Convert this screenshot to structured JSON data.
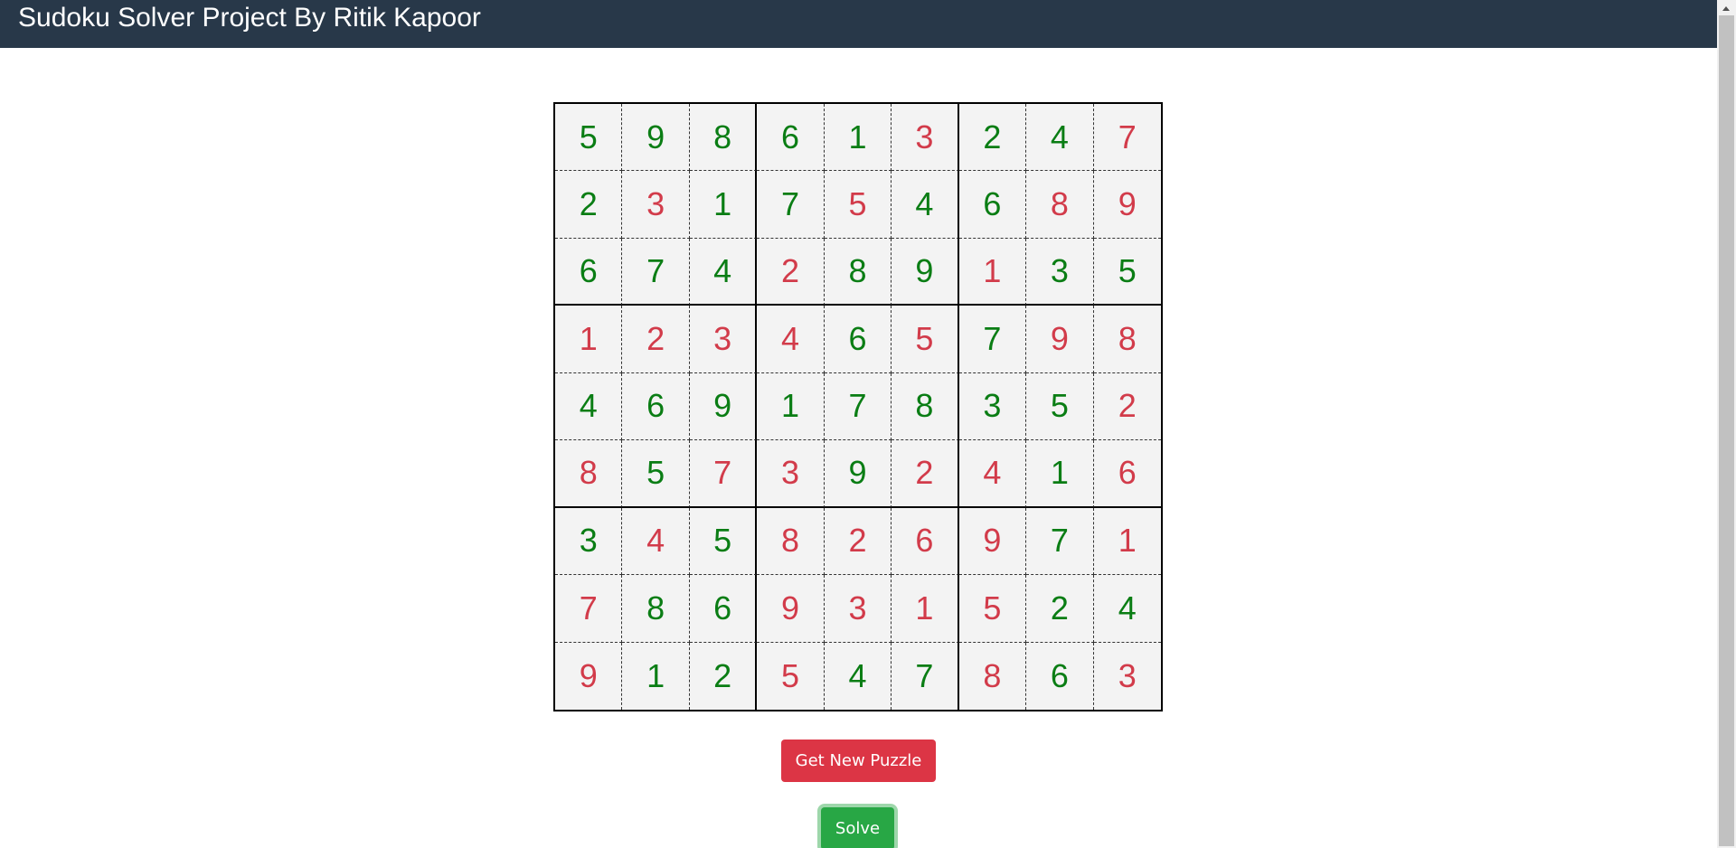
{
  "header": {
    "title": "Sudoku Solver Project By Ritik Kapoor"
  },
  "colors": {
    "header_bg": "#283849",
    "given_digit": "#0a7d14",
    "solved_digit": "#d23b4a",
    "new_puzzle_button": "#dc3545",
    "solve_button": "#28a745"
  },
  "grid": [
    [
      {
        "v": "5",
        "given": true
      },
      {
        "v": "9",
        "given": true
      },
      {
        "v": "8",
        "given": true
      },
      {
        "v": "6",
        "given": true
      },
      {
        "v": "1",
        "given": true
      },
      {
        "v": "3",
        "given": false
      },
      {
        "v": "2",
        "given": true
      },
      {
        "v": "4",
        "given": true
      },
      {
        "v": "7",
        "given": false
      }
    ],
    [
      {
        "v": "2",
        "given": true
      },
      {
        "v": "3",
        "given": false
      },
      {
        "v": "1",
        "given": true
      },
      {
        "v": "7",
        "given": true
      },
      {
        "v": "5",
        "given": false
      },
      {
        "v": "4",
        "given": true
      },
      {
        "v": "6",
        "given": true
      },
      {
        "v": "8",
        "given": false
      },
      {
        "v": "9",
        "given": false
      }
    ],
    [
      {
        "v": "6",
        "given": true
      },
      {
        "v": "7",
        "given": true
      },
      {
        "v": "4",
        "given": true
      },
      {
        "v": "2",
        "given": false
      },
      {
        "v": "8",
        "given": true
      },
      {
        "v": "9",
        "given": true
      },
      {
        "v": "1",
        "given": false
      },
      {
        "v": "3",
        "given": true
      },
      {
        "v": "5",
        "given": true
      }
    ],
    [
      {
        "v": "1",
        "given": false
      },
      {
        "v": "2",
        "given": false
      },
      {
        "v": "3",
        "given": false
      },
      {
        "v": "4",
        "given": false
      },
      {
        "v": "6",
        "given": true
      },
      {
        "v": "5",
        "given": false
      },
      {
        "v": "7",
        "given": true
      },
      {
        "v": "9",
        "given": false
      },
      {
        "v": "8",
        "given": false
      }
    ],
    [
      {
        "v": "4",
        "given": true
      },
      {
        "v": "6",
        "given": true
      },
      {
        "v": "9",
        "given": true
      },
      {
        "v": "1",
        "given": true
      },
      {
        "v": "7",
        "given": true
      },
      {
        "v": "8",
        "given": true
      },
      {
        "v": "3",
        "given": true
      },
      {
        "v": "5",
        "given": true
      },
      {
        "v": "2",
        "given": false
      }
    ],
    [
      {
        "v": "8",
        "given": false
      },
      {
        "v": "5",
        "given": true
      },
      {
        "v": "7",
        "given": false
      },
      {
        "v": "3",
        "given": false
      },
      {
        "v": "9",
        "given": true
      },
      {
        "v": "2",
        "given": false
      },
      {
        "v": "4",
        "given": false
      },
      {
        "v": "1",
        "given": true
      },
      {
        "v": "6",
        "given": false
      }
    ],
    [
      {
        "v": "3",
        "given": true
      },
      {
        "v": "4",
        "given": false
      },
      {
        "v": "5",
        "given": true
      },
      {
        "v": "8",
        "given": false
      },
      {
        "v": "2",
        "given": false
      },
      {
        "v": "6",
        "given": false
      },
      {
        "v": "9",
        "given": false
      },
      {
        "v": "7",
        "given": true
      },
      {
        "v": "1",
        "given": false
      }
    ],
    [
      {
        "v": "7",
        "given": false
      },
      {
        "v": "8",
        "given": true
      },
      {
        "v": "6",
        "given": true
      },
      {
        "v": "9",
        "given": false
      },
      {
        "v": "3",
        "given": false
      },
      {
        "v": "1",
        "given": false
      },
      {
        "v": "5",
        "given": false
      },
      {
        "v": "2",
        "given": true
      },
      {
        "v": "4",
        "given": true
      }
    ],
    [
      {
        "v": "9",
        "given": false
      },
      {
        "v": "1",
        "given": true
      },
      {
        "v": "2",
        "given": true
      },
      {
        "v": "5",
        "given": false
      },
      {
        "v": "4",
        "given": true
      },
      {
        "v": "7",
        "given": true
      },
      {
        "v": "8",
        "given": false
      },
      {
        "v": "6",
        "given": true
      },
      {
        "v": "3",
        "given": false
      }
    ]
  ],
  "buttons": {
    "new_puzzle_label": "Get New Puzzle",
    "solve_label": "Solve"
  }
}
